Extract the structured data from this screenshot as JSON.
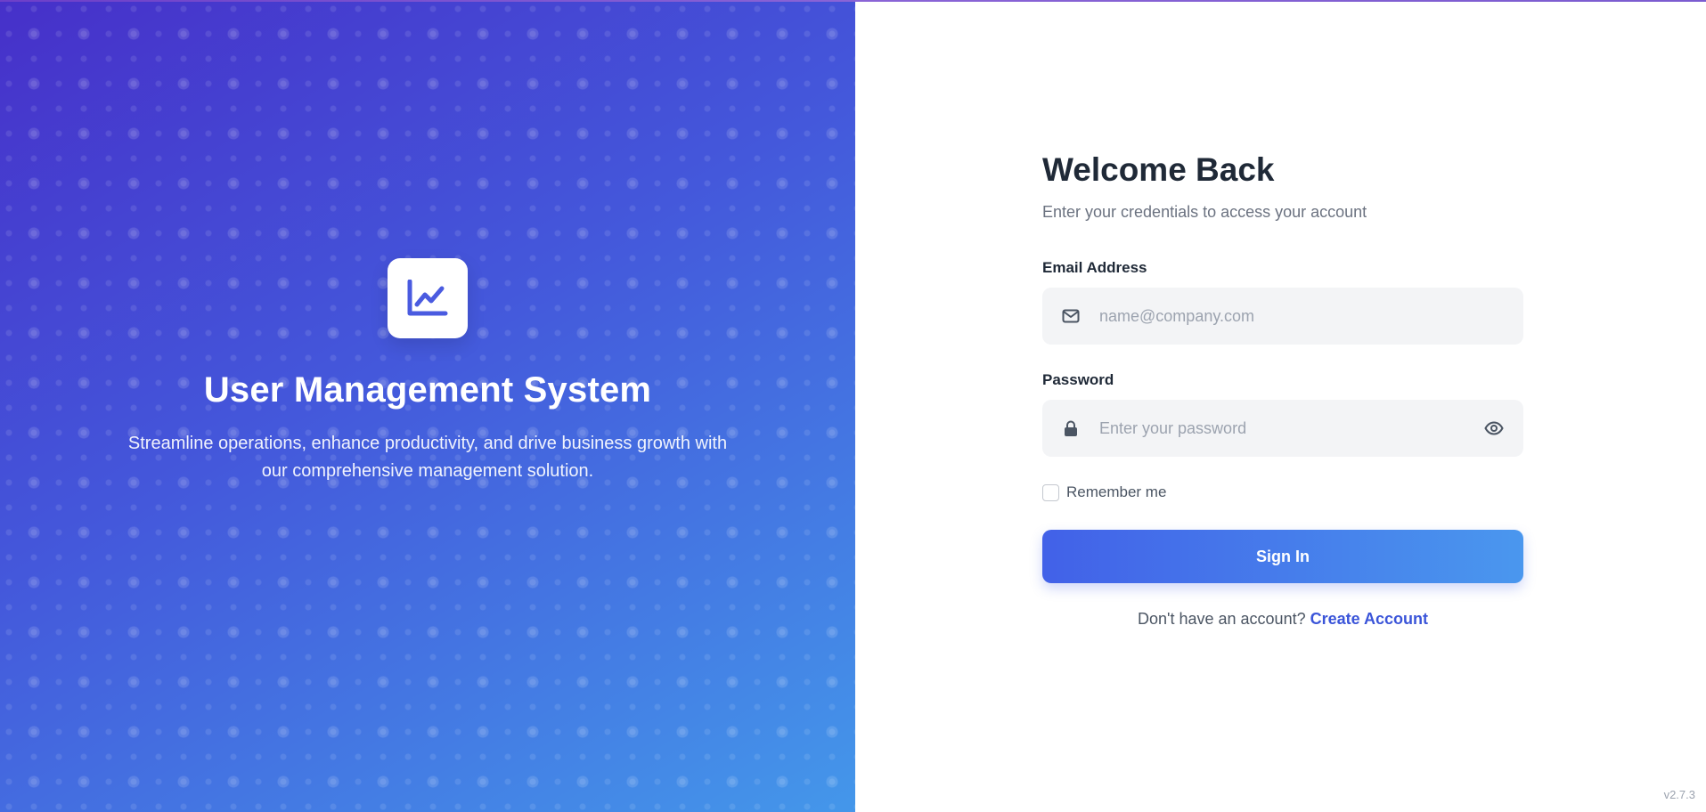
{
  "brand": {
    "logo_icon": "line-chart-icon",
    "title": "User Management System",
    "subtitle": "Streamline operations, enhance productivity, and drive business growth with our comprehensive management solution."
  },
  "form": {
    "title": "Welcome Back",
    "subtitle": "Enter your credentials to access your account",
    "email": {
      "label": "Email Address",
      "placeholder": "name@company.com",
      "value": "",
      "icon": "envelope-icon"
    },
    "password": {
      "label": "Password",
      "placeholder": "Enter your password",
      "value": "",
      "icon": "lock-icon",
      "toggle_icon": "eye-icon"
    },
    "remember_label": "Remember me",
    "remember_checked": false,
    "submit_label": "Sign In",
    "signup_prompt": "Don't have an account?",
    "signup_link": "Create Account"
  },
  "footer": {
    "version": "v2.7.3"
  },
  "colors": {
    "gradient_start": "#4630c9",
    "gradient_end": "#4497ea",
    "accent": "#3b55d9",
    "button_start": "#4261e8",
    "button_end": "#4a97ee"
  }
}
